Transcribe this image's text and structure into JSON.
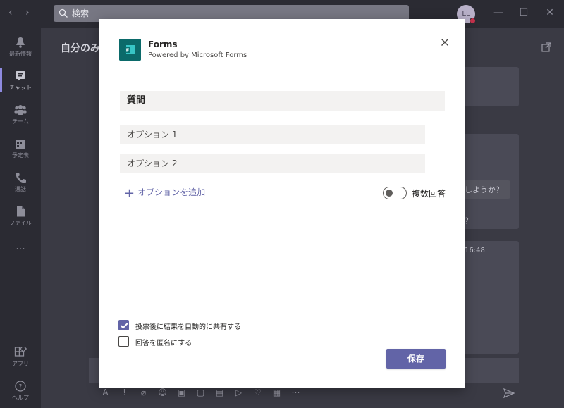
{
  "titlebar": {
    "search_placeholder": "検索",
    "avatar_initials": "LL"
  },
  "rail": {
    "items": [
      {
        "label": "最新情報"
      },
      {
        "label": "チャット"
      },
      {
        "label": "チーム"
      },
      {
        "label": "予定表"
      },
      {
        "label": "通話"
      },
      {
        "label": "ファイル"
      },
      {
        "label": "..."
      },
      {
        "label": "アプリ"
      },
      {
        "label": "ヘルプ"
      }
    ]
  },
  "background": {
    "chat_title": "自分のみ",
    "snippet_1": "しようか？",
    "snippet_2": "？",
    "timestamp": "16:48"
  },
  "dialog": {
    "app_name": "Forms",
    "app_subtitle": "Powered by Microsoft Forms",
    "question": "質問",
    "options": [
      "オプション 1",
      "オプション 2"
    ],
    "add_option": "オプションを追加",
    "multi_answer_label": "複数回答",
    "multi_answer_enabled": false,
    "share_results_label": "投票後に結果を自動的に共有する",
    "share_results_checked": true,
    "anonymous_label": "回答を匿名にする",
    "anonymous_checked": false,
    "save_label": "保存"
  },
  "colors": {
    "accent": "#6264a7",
    "forms_logo": "#0b6a6a",
    "chrome": "#2b2b33"
  }
}
